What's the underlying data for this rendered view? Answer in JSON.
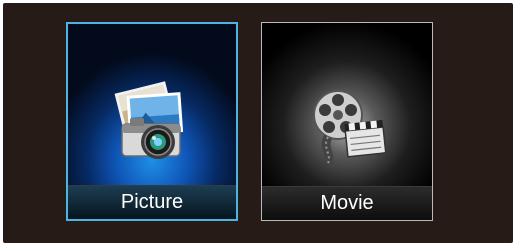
{
  "menu": {
    "tiles": [
      {
        "label": "Picture",
        "icon": "camera-photos-icon",
        "selected": true,
        "accent": "#4bb4e0"
      },
      {
        "label": "Movie",
        "icon": "film-reel-clapperboard-icon",
        "selected": false,
        "accent": "#b9b9b9"
      }
    ]
  }
}
